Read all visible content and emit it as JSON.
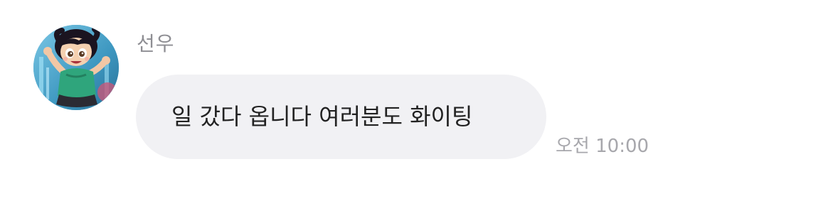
{
  "message": {
    "sender_name": "선우",
    "avatar_icon": "cartoon-girl-avatar",
    "text": "일 갔다 옵니다 여러분도 화이팅",
    "time": "오전 10:00"
  },
  "colors": {
    "bubble_bg": "#f1f1f4",
    "sender_name": "#8e8e93",
    "message_text": "#222222",
    "timestamp": "#a7a7ac"
  }
}
